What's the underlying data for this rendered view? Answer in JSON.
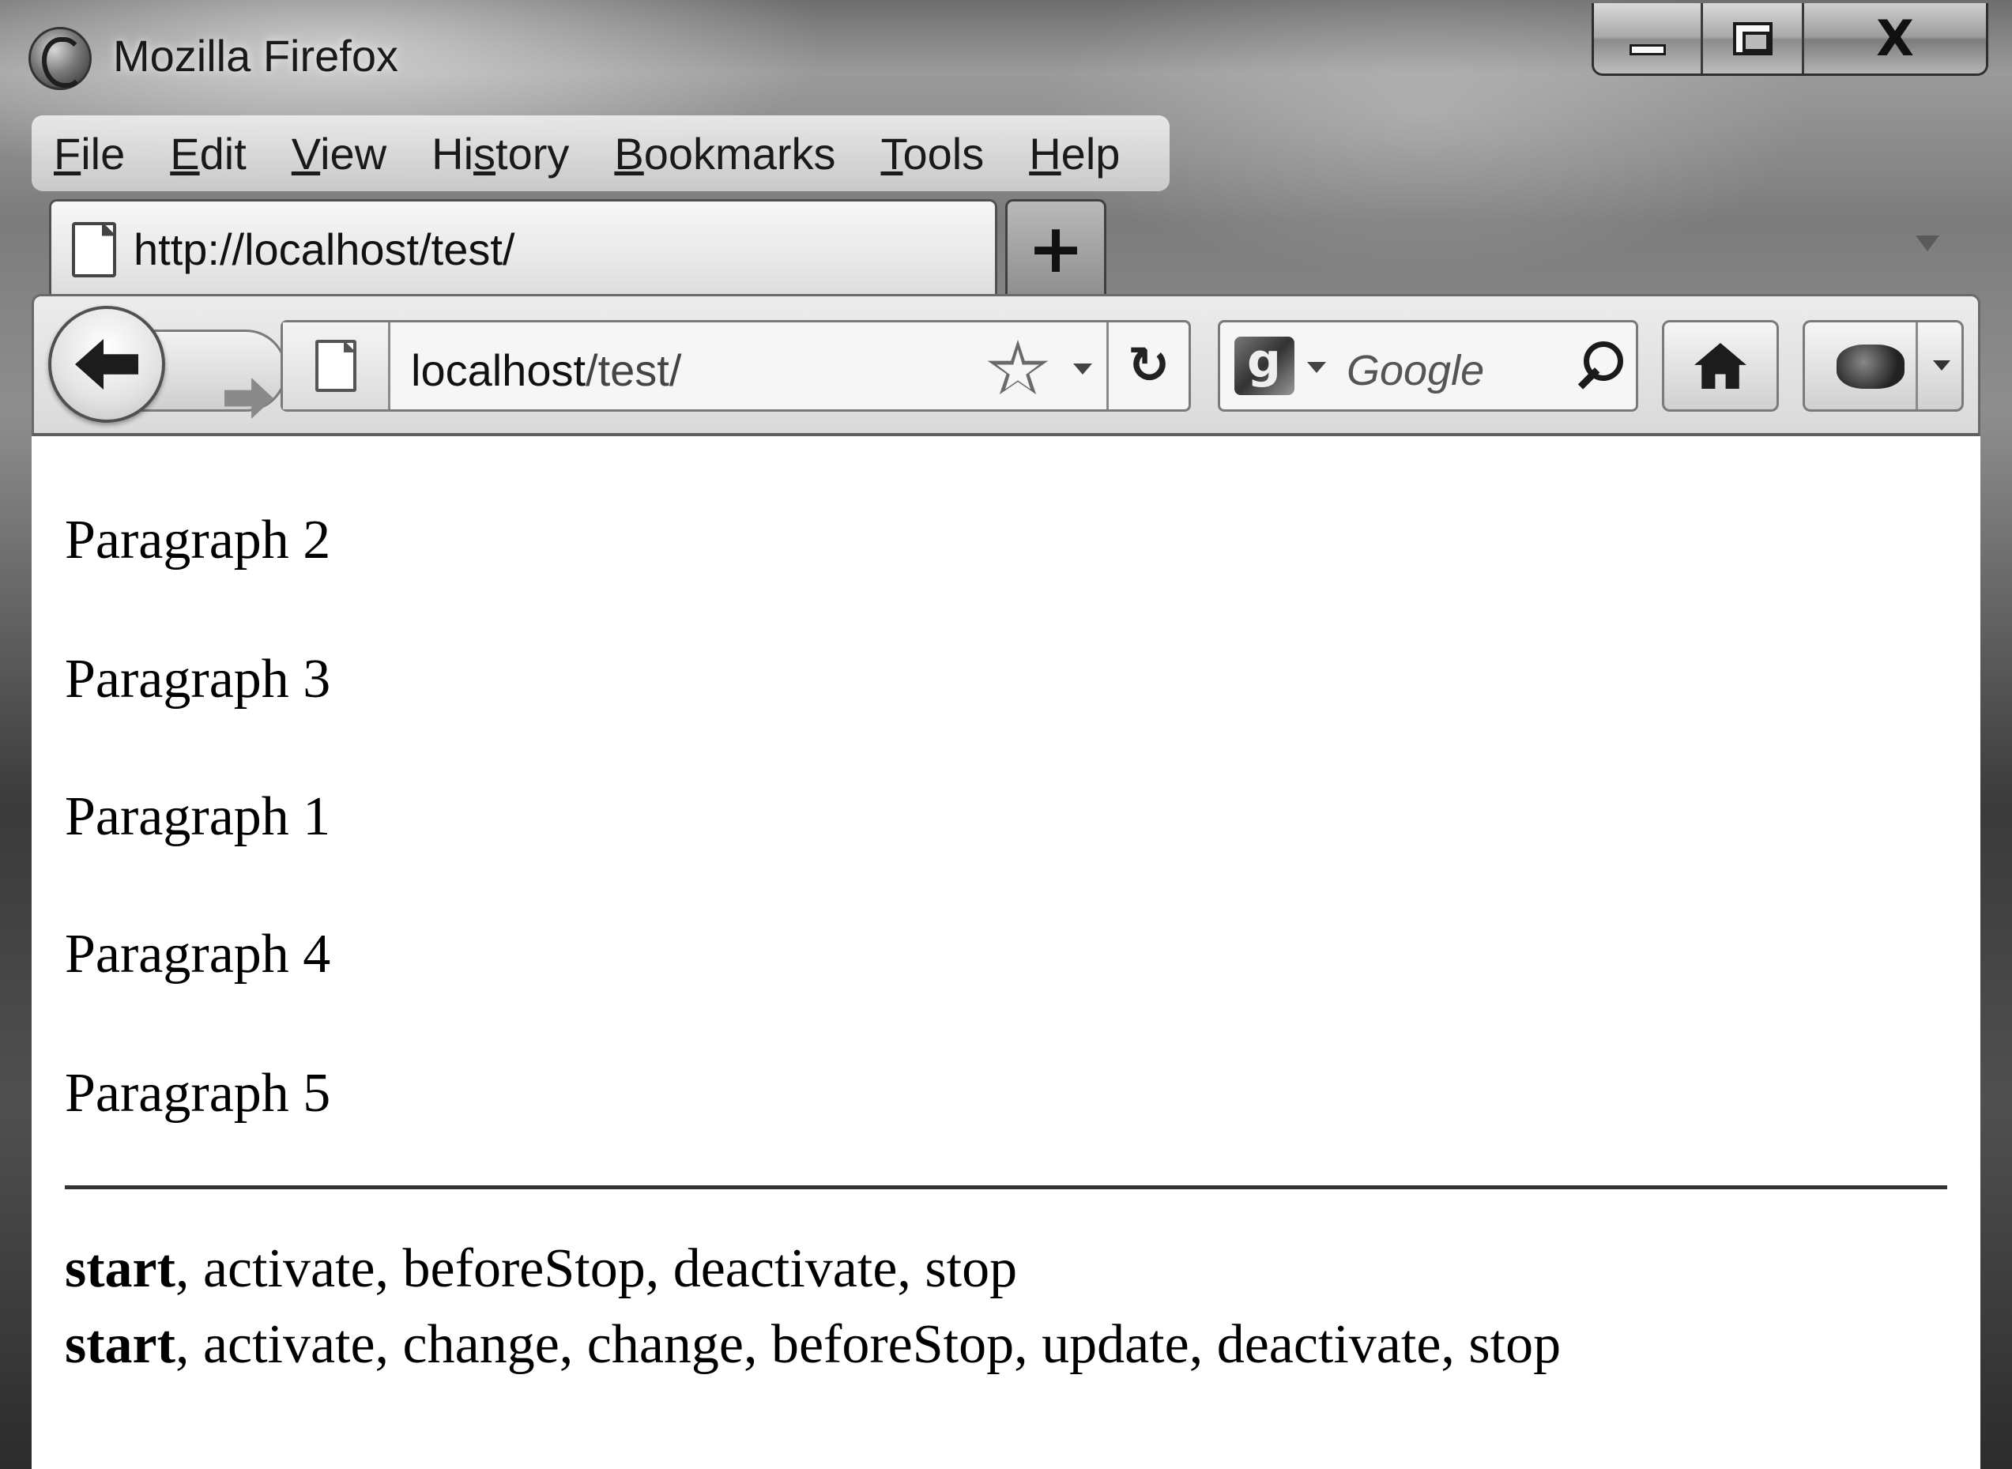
{
  "window": {
    "title": "Mozilla Firefox",
    "controls": {
      "close": "X"
    }
  },
  "menu": {
    "items": [
      {
        "pre": "",
        "key": "F",
        "post": "ile"
      },
      {
        "pre": "",
        "key": "E",
        "post": "dit"
      },
      {
        "pre": "",
        "key": "V",
        "post": "iew"
      },
      {
        "pre": "Hi",
        "key": "s",
        "post": "tory"
      },
      {
        "pre": "",
        "key": "B",
        "post": "ookmarks"
      },
      {
        "pre": "",
        "key": "T",
        "post": "ools"
      },
      {
        "pre": "",
        "key": "H",
        "post": "elp"
      }
    ]
  },
  "tabs": {
    "active_title": "http://localhost/test/",
    "new_tab_label": "+"
  },
  "navigation": {
    "url_host": "localhost",
    "url_path": "/test/",
    "reload_glyph": "↻",
    "search_placeholder": "Google"
  },
  "content": {
    "paragraphs": [
      "Paragraph 2",
      "Paragraph 3",
      "Paragraph 1",
      "Paragraph 4",
      "Paragraph 5"
    ],
    "event_lines": [
      {
        "bold": "start",
        "rest": ", activate, beforeStop, deactivate, stop"
      },
      {
        "bold": "start",
        "rest": ", activate, change, change, beforeStop, update, deactivate, stop"
      }
    ]
  },
  "colors": {
    "content_background": "#ffffff",
    "text": "#000000",
    "chrome_light": "#ececec",
    "chrome_dark": "#3a3a3a"
  }
}
